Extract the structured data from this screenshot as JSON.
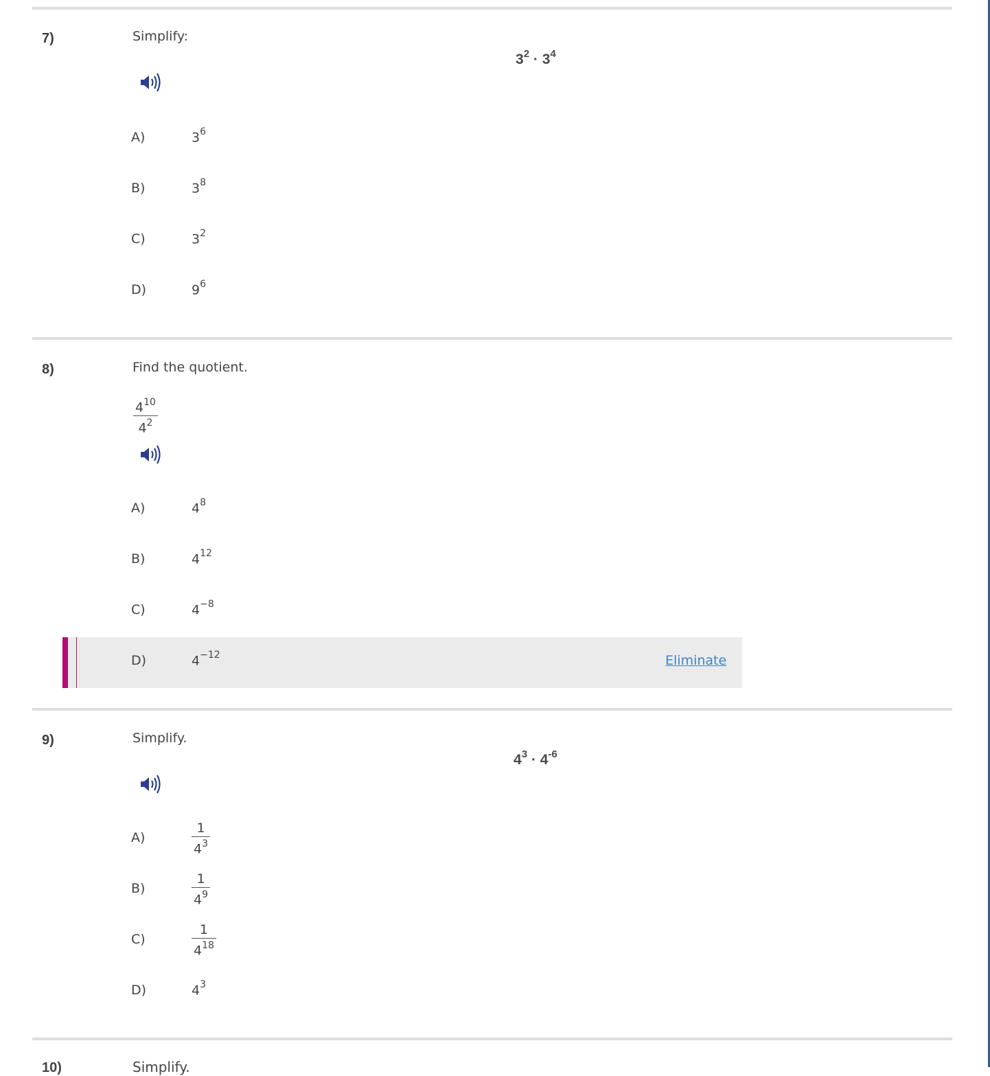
{
  "questions": [
    {
      "number": "7)",
      "prompt": "Simplify:",
      "expression": {
        "base1": "3",
        "exp1": "2",
        "op": "·",
        "base2": "3",
        "exp2": "4"
      },
      "options": [
        {
          "letter": "A)",
          "base": "3",
          "exp": "6"
        },
        {
          "letter": "B)",
          "base": "3",
          "exp": "8"
        },
        {
          "letter": "C)",
          "base": "3",
          "exp": "2"
        },
        {
          "letter": "D)",
          "base": "9",
          "exp": "6"
        }
      ]
    },
    {
      "number": "8)",
      "prompt": "Find the quotient.",
      "fraction": {
        "num_base": "4",
        "num_exp": "10",
        "den_base": "4",
        "den_exp": "2"
      },
      "options": [
        {
          "letter": "A)",
          "base": "4",
          "exp": "8"
        },
        {
          "letter": "B)",
          "base": "4",
          "exp": "12"
        },
        {
          "letter": "C)",
          "base": "4",
          "exp": "−8"
        },
        {
          "letter": "D)",
          "base": "4",
          "exp": "−12"
        }
      ],
      "eliminate_label": "Eliminate"
    },
    {
      "number": "9)",
      "prompt": "Simplify.",
      "expression": {
        "base1": "4",
        "exp1": "3",
        "op": "·",
        "base2": "4",
        "exp2": "-6"
      },
      "options": [
        {
          "letter": "A)",
          "num": "1",
          "den_base": "4",
          "den_exp": "3"
        },
        {
          "letter": "B)",
          "num": "1",
          "den_base": "4",
          "den_exp": "9"
        },
        {
          "letter": "C)",
          "num": "1",
          "den_base": "4",
          "den_exp": "18"
        },
        {
          "letter": "D)",
          "base": "4",
          "exp": "3"
        }
      ]
    }
  ],
  "next_question": {
    "number": "10)",
    "prompt": "Simplify."
  },
  "colors": {
    "accent": "#b30d74",
    "link": "#3a86c8",
    "speaker": "#2c3f8f",
    "frame": "#2f5e93"
  }
}
